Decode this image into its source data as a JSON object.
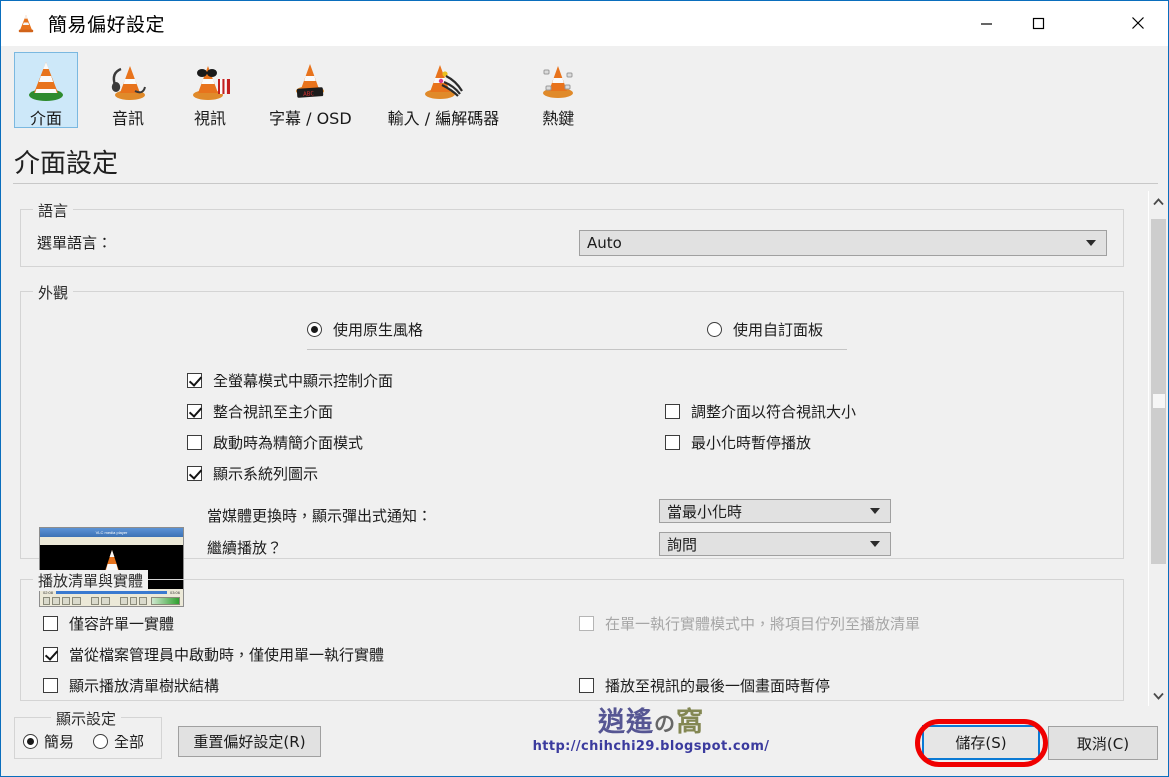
{
  "window": {
    "title": "簡易偏好設定",
    "icon": "vlc-cone-icon",
    "controls": {
      "minimize": "—",
      "maximize": "▢",
      "close": "✕"
    }
  },
  "toolbar": {
    "items": [
      {
        "label": "介面",
        "icon": "vlc-cone-green-icon",
        "selected": true
      },
      {
        "label": "音訊",
        "icon": "vlc-cone-headphones-icon",
        "selected": false
      },
      {
        "label": "視訊",
        "icon": "vlc-cone-glasses-icon",
        "selected": false
      },
      {
        "label": "字幕 / OSD",
        "icon": "vlc-cone-subtitles-icon",
        "selected": false
      },
      {
        "label": "輸入 / 編解碼器",
        "icon": "vlc-cone-cables-icon",
        "selected": false
      },
      {
        "label": "熱鍵",
        "icon": "vlc-cone-keyboard-icon",
        "selected": false
      }
    ]
  },
  "page": {
    "heading": "介面設定"
  },
  "language_group": {
    "title": "語言",
    "menu_language_label": "選單語言：",
    "menu_language_value": "Auto",
    "menu_language_options": [
      "Auto"
    ]
  },
  "appearance_group": {
    "title": "外觀",
    "style_native": "使用原生風格",
    "style_custom": "使用自訂面板",
    "style_selected": "native",
    "preview_thumb": {
      "icon": "vlc-player-preview-icon",
      "window_title": "VLC media player",
      "menu": "Media  Playback  Audio  Video  Subtitle  Tools  View  Help",
      "time_left": "02:08",
      "time_right": "03:06"
    },
    "checkboxes_left": [
      {
        "label": "全螢幕模式中顯示控制介面",
        "checked": true,
        "disabled": false
      },
      {
        "label": "整合視訊至主介面",
        "checked": true,
        "disabled": false
      },
      {
        "label": "啟動時為精簡介面模式",
        "checked": false,
        "disabled": false
      },
      {
        "label": "顯示系統列圖示",
        "checked": true,
        "disabled": false
      }
    ],
    "checkboxes_right": [
      {
        "label": "調整介面以符合視訊大小",
        "checked": false,
        "disabled": false
      },
      {
        "label": "最小化時暫停播放",
        "checked": false,
        "disabled": false
      }
    ],
    "popup_label": "當媒體更換時，顯示彈出式通知：",
    "popup_value": "當最小化時",
    "popup_options": [
      "當最小化時"
    ],
    "resume_label": "繼續播放？",
    "resume_value": "詢問",
    "resume_options": [
      "詢問"
    ]
  },
  "playlist_group": {
    "title": "播放清單與實體",
    "checkboxes_left": [
      {
        "label": "僅容許單一實體",
        "checked": false,
        "disabled": false
      },
      {
        "label": "當從檔案管理員中啟動時，僅使用單一執行實體",
        "checked": true,
        "disabled": false
      },
      {
        "label": "顯示播放清單樹狀結構",
        "checked": false,
        "disabled": false
      }
    ],
    "checkboxes_right": [
      {
        "label": "在單一執行實體模式中，將項目佇列至播放清單",
        "checked": false,
        "disabled": true
      },
      {
        "label": "播放至視訊的最後一個畫面時暫停",
        "checked": false,
        "disabled": false
      }
    ]
  },
  "bottom_bar": {
    "show_settings_title": "顯示設定",
    "show_simple": "簡易",
    "show_all": "全部",
    "show_selected": "simple",
    "reset_button": "重置偏好設定(R)",
    "save_button": "儲存(S)",
    "cancel_button": "取消(C)"
  },
  "watermark": {
    "logo_part1": "逍遙",
    "logo_part2": "の",
    "logo_part3": "窩",
    "url": "http://chihchi29.blogspot.com/"
  },
  "scrollbar": {
    "up_arrow": "⌃",
    "down_arrow": "⌄"
  },
  "colors": {
    "window_border": "#0a6ebd",
    "tab_selected_bg": "#cde8f9",
    "tab_selected_border": "#7ab8e0",
    "dialog_bg": "#f0f0f0",
    "control_bg": "#e1e1e1",
    "highlight_red": "#f00000",
    "focus_blue": "#0a7ad4",
    "watermark_blue": "#3b3b9e"
  }
}
